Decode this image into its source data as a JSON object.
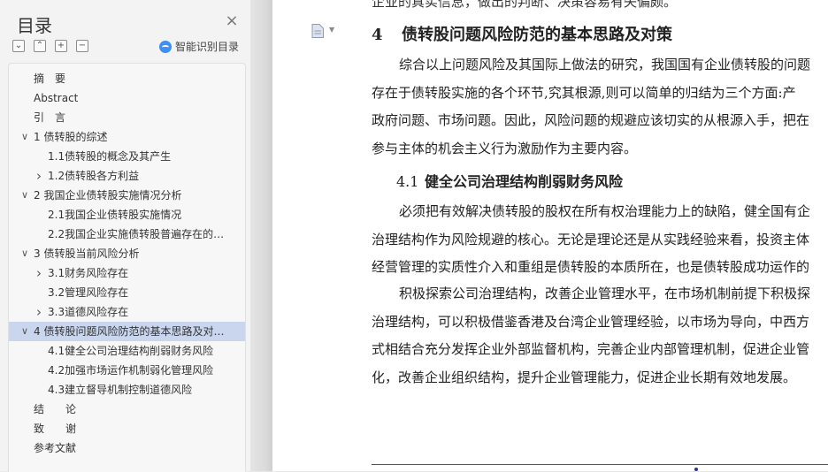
{
  "toc": {
    "title": "目录",
    "smart_label": "智能识别目录",
    "items": [
      {
        "label": "摘　要",
        "level": 0,
        "expand": "none"
      },
      {
        "label": "Abstract",
        "level": 0,
        "expand": "none"
      },
      {
        "label": "引　言",
        "level": 0,
        "expand": "none"
      },
      {
        "label": "1 债转股的综述",
        "level": 0,
        "expand": "open"
      },
      {
        "label": "1.1债转股的概念及其产生",
        "level": 1,
        "expand": "none"
      },
      {
        "label": "1.2债转股各方利益",
        "level": 1,
        "expand": "closed"
      },
      {
        "label": "2  我国企业债转股实施情况分析",
        "level": 0,
        "expand": "open"
      },
      {
        "label": "2.1我国企业债转股实施情况",
        "level": 1,
        "expand": "none"
      },
      {
        "label": "2.2我国企业实施债转股普遍存在的…",
        "level": 1,
        "expand": "none"
      },
      {
        "label": "3  债转股当前风险分析",
        "level": 0,
        "expand": "open"
      },
      {
        "label": "3.1财务风险存在",
        "level": 1,
        "expand": "closed"
      },
      {
        "label": "3.2管理风险存在",
        "level": 1,
        "expand": "none"
      },
      {
        "label": "3.3道德风险存在",
        "level": 1,
        "expand": "closed"
      },
      {
        "label": "4  债转股问题风险防范的基本思路及对…",
        "level": 0,
        "expand": "open",
        "selected": true
      },
      {
        "label": "4.1健全公司治理结构削弱财务风险",
        "level": 1,
        "expand": "none"
      },
      {
        "label": "4.2加强市场运作机制弱化管理风险",
        "level": 1,
        "expand": "none"
      },
      {
        "label": "4.3建立督导机制控制道德风险",
        "level": 1,
        "expand": "none"
      },
      {
        "label": "结　　论",
        "level": 0,
        "expand": "none"
      },
      {
        "label": "致　　谢",
        "level": 0,
        "expand": "none"
      },
      {
        "label": "参考文献",
        "level": 0,
        "expand": "none"
      }
    ]
  },
  "doc": {
    "top_cut": "企业的真实信息，做出的判断、决策容易有失偏颇。",
    "h1_num": "4",
    "h1_text": "债转股问题风险防范的基本思路及对策",
    "para1": [
      "综合以上问题风险及其国际上做法的研究，我国国有企业债转股的问题",
      "存在于债转股实施的各个环节,究其根源,则可以简单的归结为三个方面:产",
      "政府问题、市场问题。因此，风险问题的规避应该切实的从根源入手，把在",
      "参与主体的机会主义行为激励作为主要内容。"
    ],
    "h2_num": "4.1",
    "h2_text": "健全公司治理结构削弱财务风险",
    "para2": [
      "必须把有效解决债转股的股权在所有权治理能力上的缺陷，健全国有企",
      "治理结构作为风险规避的核心。无论是理论还是从实践经验来看，投资主体",
      "经营管理的实质性介入和重组是债转股的本质所在，也是债转股成功运作的"
    ],
    "para3": [
      "积极探索公司治理结构，改善企业管理水平，在市场机制前提下积极探",
      "治理结构，可以积极借鉴香港及台湾企业管理经验，以市场为导向，中西方",
      "式相结合充分发挥企业外部监督机构，完善企业内部管理机制，促进企业管",
      "化，改善企业组织结构，提升企业管理能力，促进企业长期有效地发展。"
    ]
  }
}
